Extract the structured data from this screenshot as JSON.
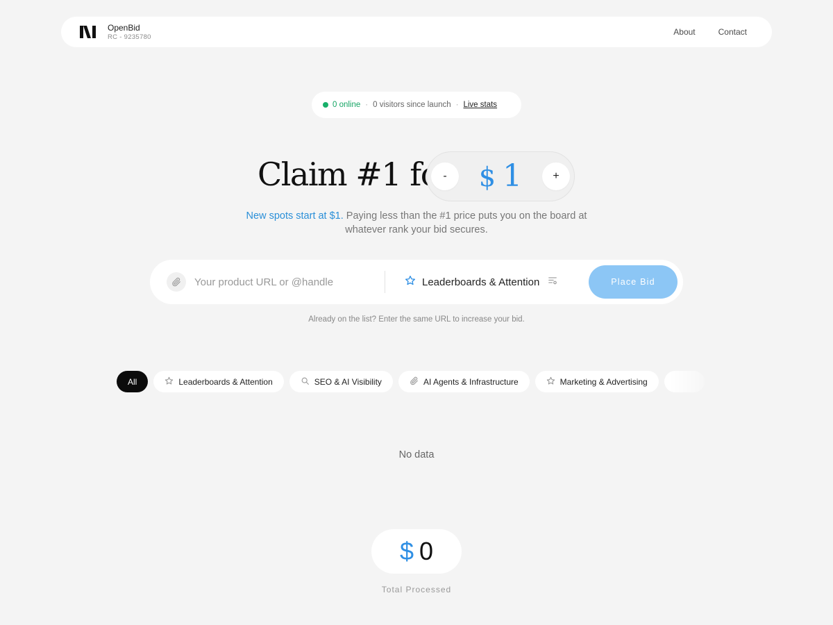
{
  "header": {
    "brand_name": "OpenBid",
    "brand_sub": "RC - 9235780",
    "nav": [
      {
        "label": "About"
      },
      {
        "label": "Contact"
      }
    ]
  },
  "status": {
    "online": "0 online",
    "visitors": "0 visitors since launch",
    "live_stats": "Live stats",
    "online_color": "#18b06a"
  },
  "hero": {
    "title": "Claim #1 for",
    "currency": "$",
    "price": "1",
    "minus": "-",
    "plus": "+",
    "subtext_highlight": "New spots start at $1.",
    "subtext_rest": " Paying less than the #1 price puts you on the board at whatever rank your bid secures."
  },
  "bid": {
    "url_placeholder": "Your product URL or @handle",
    "url_value": "",
    "category": "Leaderboards & Attention",
    "place_bid": "Place Bid",
    "hint": "Already on the list? Enter the same URL to increase your bid."
  },
  "filters": {
    "chips": [
      {
        "label": "All",
        "icon": "",
        "active": true
      },
      {
        "label": "Leaderboards & Attention",
        "icon": "star-icon",
        "active": false
      },
      {
        "label": "SEO & AI Visibility",
        "icon": "search-icon",
        "active": false
      },
      {
        "label": "AI Agents & Infrastructure",
        "icon": "paperclip-icon",
        "active": false
      },
      {
        "label": "Marketing & Advertising",
        "icon": "star-icon",
        "active": false
      }
    ]
  },
  "empty": {
    "text": "No data"
  },
  "total": {
    "currency": "$",
    "value": "0",
    "label": "Total Processed"
  },
  "colors": {
    "accent": "#2f8fe4",
    "button": "#8cc6f5",
    "background": "#f4f4f4"
  }
}
